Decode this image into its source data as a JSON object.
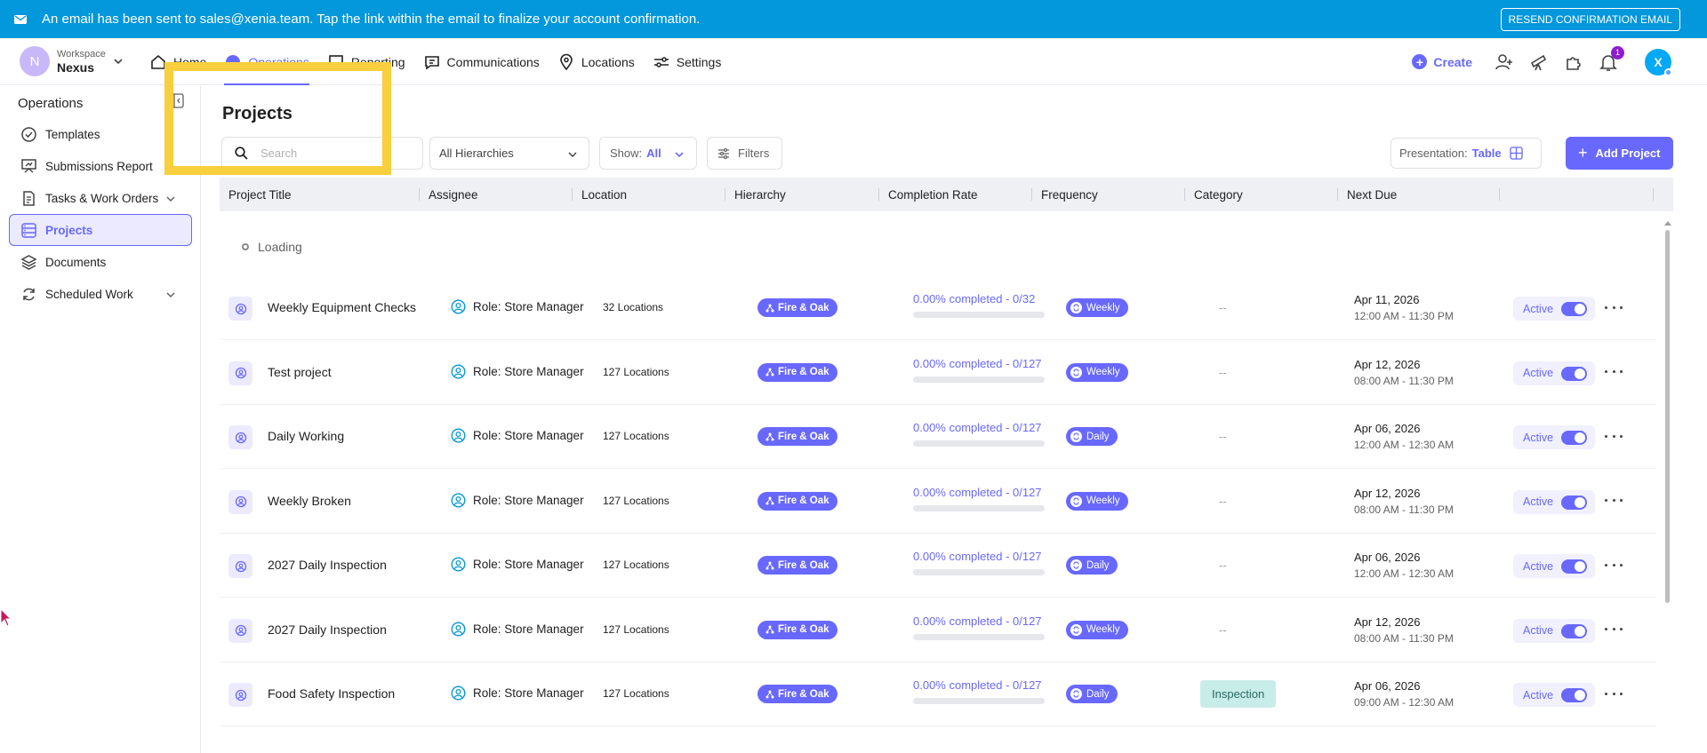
{
  "banner": {
    "message": "An email has been sent to sales@xenia.team. Tap the link within the email to finalize your account confirmation.",
    "resend_label": "RESEND CONFIRMATION EMAIL",
    "icon": "mail-icon"
  },
  "workspace": {
    "label": "Workspace",
    "name": "Nexus",
    "avatar_letter": "N"
  },
  "nav": {
    "items": [
      {
        "label": "Home",
        "icon": "home-icon"
      },
      {
        "label": "Operations",
        "icon": "operations-icon",
        "active": true
      },
      {
        "label": "Reporting",
        "icon": "reporting-icon"
      },
      {
        "label": "Communications",
        "icon": "chat-icon"
      },
      {
        "label": "Locations",
        "icon": "location-pin-icon"
      },
      {
        "label": "Settings",
        "icon": "settings-sliders-icon"
      }
    ],
    "create_label": "Create",
    "notification_count": "1",
    "user_initial": "X"
  },
  "sidebar": {
    "title": "Operations",
    "items": [
      {
        "label": "Templates",
        "icon": "check-circle-icon"
      },
      {
        "label": "Submissions Report",
        "icon": "presentation-icon"
      },
      {
        "label": "Tasks & Work Orders",
        "icon": "document-icon",
        "has_children": true
      },
      {
        "label": "Projects",
        "icon": "database-icon",
        "active": true
      },
      {
        "label": "Documents",
        "icon": "layers-icon"
      },
      {
        "label": "Scheduled Work",
        "icon": "refresh-icon",
        "has_children": true
      }
    ]
  },
  "main": {
    "title": "Projects",
    "search_placeholder": "Search",
    "hierarchy_select": "All Hierarchies",
    "show_label": "Show:",
    "show_value": "All",
    "filters_label": "Filters",
    "presentation_label": "Presentation:",
    "presentation_value": "Table",
    "add_project_label": "Add Project",
    "loading_text": "Loading",
    "columns": [
      "Project Title",
      "Assignee",
      "Location",
      "Hierarchy",
      "Completion Rate",
      "Frequency",
      "Category",
      "Next Due"
    ]
  },
  "rows": [
    {
      "title": "Weekly Equipment Checks",
      "assignee": "Role: Store Manager",
      "location": "32 Locations",
      "hierarchy": "Fire & Oak",
      "completion": "0.00% completed - 0/32",
      "progress": 0,
      "frequency": "Weekly",
      "category": "--",
      "due_date": "Apr 11, 2026",
      "due_time": "12:00 AM - 11:30 PM",
      "status": "Active"
    },
    {
      "title": "Test project",
      "assignee": "Role: Store Manager",
      "location": "127 Locations",
      "hierarchy": "Fire & Oak",
      "completion": "0.00% completed - 0/127",
      "progress": 0,
      "frequency": "Weekly",
      "category": "--",
      "due_date": "Apr 12, 2026",
      "due_time": "08:00 AM - 11:30 PM",
      "status": "Active"
    },
    {
      "title": "Daily Working",
      "assignee": "Role: Store Manager",
      "location": "127 Locations",
      "hierarchy": "Fire & Oak",
      "completion": "0.00% completed - 0/127",
      "progress": 0,
      "frequency": "Daily",
      "category": "--",
      "due_date": "Apr 06, 2026",
      "due_time": "12:00 AM - 12:30 AM",
      "status": "Active"
    },
    {
      "title": "Weekly Broken",
      "assignee": "Role: Store Manager",
      "location": "127 Locations",
      "hierarchy": "Fire & Oak",
      "completion": "0.00% completed - 0/127",
      "progress": 0,
      "frequency": "Weekly",
      "category": "--",
      "due_date": "Apr 12, 2026",
      "due_time": "08:00 AM - 11:30 PM",
      "status": "Active"
    },
    {
      "title": "2027 Daily Inspection",
      "assignee": "Role: Store Manager",
      "location": "127 Locations",
      "hierarchy": "Fire & Oak",
      "completion": "0.00% completed - 0/127",
      "progress": 0,
      "frequency": "Daily",
      "category": "--",
      "due_date": "Apr 06, 2026",
      "due_time": "12:00 AM - 12:30 AM",
      "status": "Active"
    },
    {
      "title": "2027 Daily Inspection",
      "assignee": "Role: Store Manager",
      "location": "127 Locations",
      "hierarchy": "Fire & Oak",
      "completion": "0.00% completed - 0/127",
      "progress": 0,
      "frequency": "Weekly",
      "category": "--",
      "due_date": "Apr 12, 2026",
      "due_time": "08:00 AM - 11:30 PM",
      "status": "Active"
    },
    {
      "title": "Food Safety Inspection",
      "assignee": "Role: Store Manager",
      "location": "127 Locations",
      "hierarchy": "Fire & Oak",
      "completion": "0.00% completed - 0/127",
      "progress": 0,
      "frequency": "Daily",
      "category": "Inspection",
      "due_date": "Apr 06, 2026",
      "due_time": "09:00 AM - 12:30 AM",
      "status": "Active"
    }
  ]
}
